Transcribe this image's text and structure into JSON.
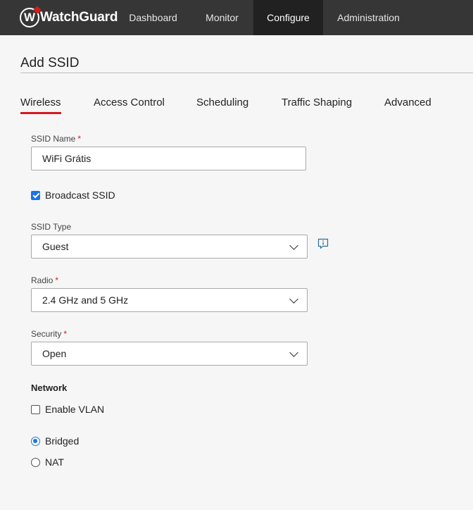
{
  "app": {
    "brand": "WatchGuard",
    "nav": [
      {
        "label": "Dashboard",
        "active": false
      },
      {
        "label": "Monitor",
        "active": false
      },
      {
        "label": "Configure",
        "active": true
      },
      {
        "label": "Administration",
        "active": false
      }
    ]
  },
  "page": {
    "title": "Add SSID"
  },
  "tabs": [
    {
      "label": "Wireless",
      "active": true
    },
    {
      "label": "Access Control",
      "active": false
    },
    {
      "label": "Scheduling",
      "active": false
    },
    {
      "label": "Traffic Shaping",
      "active": false
    },
    {
      "label": "Advanced",
      "active": false
    }
  ],
  "form": {
    "ssid_name": {
      "label": "SSID Name",
      "required_mark": "*",
      "value": "WiFi Grátis"
    },
    "broadcast_ssid": {
      "label": "Broadcast SSID",
      "checked": true
    },
    "ssid_type": {
      "label": "SSID Type",
      "value": "Guest",
      "info_icon": "info-icon"
    },
    "radio": {
      "label": "Radio",
      "required_mark": "*",
      "value": "2.4 GHz and 5 GHz"
    },
    "security": {
      "label": "Security",
      "required_mark": "*",
      "value": "Open"
    },
    "network": {
      "heading": "Network",
      "enable_vlan": {
        "label": "Enable VLAN",
        "checked": false
      },
      "mode_options": [
        {
          "label": "Bridged",
          "selected": true
        },
        {
          "label": "NAT",
          "selected": false
        }
      ]
    }
  },
  "colors": {
    "topbar": "#363636",
    "topbar_active": "#212121",
    "accent_red": "#d71920",
    "control_blue": "#1a73e8",
    "background": "#f6f6f6"
  }
}
